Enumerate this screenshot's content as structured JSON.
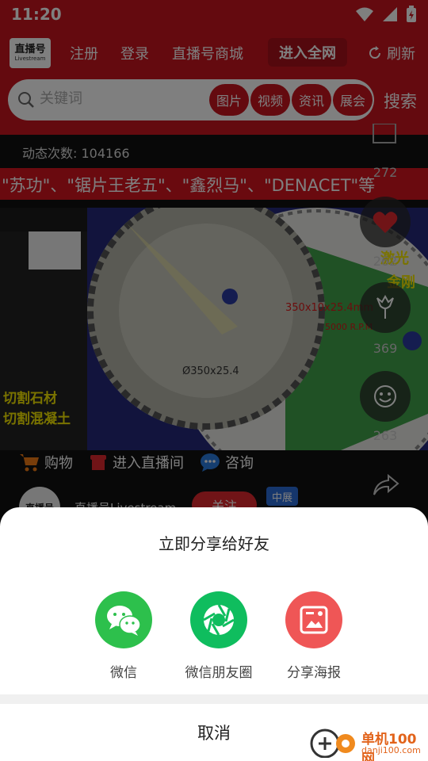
{
  "status_bar": {
    "time": "11:20"
  },
  "header": {
    "logo_main": "直播号",
    "logo_sub": "Livestream",
    "nav": [
      "注册",
      "登录",
      "直播号商城"
    ],
    "enter_all": "进入全网",
    "refresh": "刷新"
  },
  "search": {
    "placeholder": "关键词",
    "chips": [
      "图片",
      "视频",
      "资讯",
      "展会"
    ],
    "button": "搜索"
  },
  "content": {
    "dynamic_count": "动态次数: 104166",
    "ticker_text": "\"苏功\"、\"锯片王老五\"、\"鑫烈马\"、\"DENACET\"等",
    "right_counts": [
      "272",
      "262",
      "369",
      "263"
    ],
    "actions": [
      "购物",
      "进入直播间",
      "咨询"
    ],
    "anchor_avatar": "直播号",
    "anchor_name": "直播号Livestream",
    "follow": "关注",
    "tag": "中展"
  },
  "share_sheet": {
    "title": "立即分享给好友",
    "options": [
      "微信",
      "微信朋友圈",
      "分享海报"
    ],
    "cancel": "取消"
  },
  "watermark": {
    "line1": "单机100网",
    "line2": "danji100.com"
  },
  "colors": {
    "brand_red": "#c8141e",
    "wechat_green": "#2dc04c",
    "moments_green": "#0fbd5e",
    "poster_red": "#ef5656"
  }
}
